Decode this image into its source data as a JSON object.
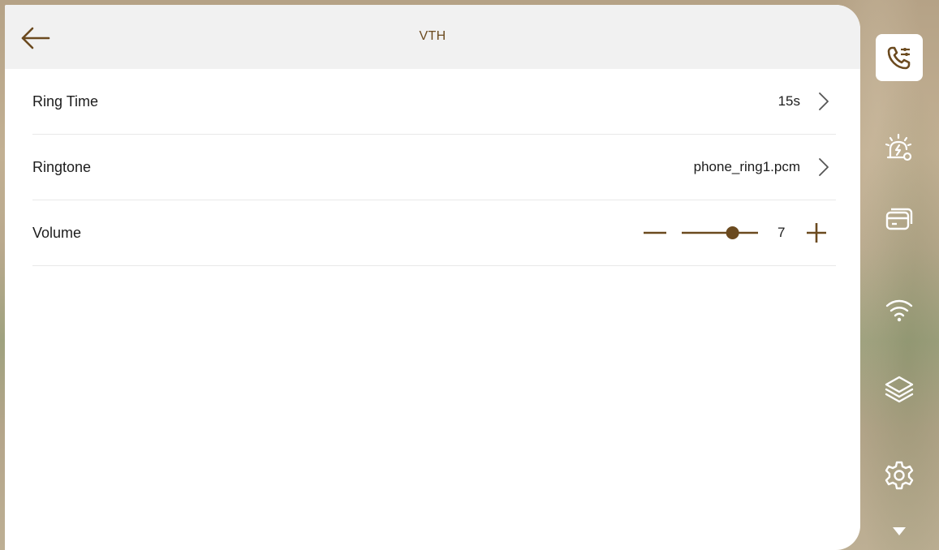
{
  "header": {
    "title": "VTH",
    "back_icon": "arrow-left-icon"
  },
  "settings": [
    {
      "label": "Ring Time",
      "value": "15s"
    },
    {
      "label": "Ringtone",
      "value": "phone_ring1.pcm"
    },
    {
      "label": "Volume",
      "value": "7",
      "level": 7
    }
  ],
  "sidebar": {
    "items": [
      {
        "icon": "call-settings-icon",
        "active": true
      },
      {
        "icon": "alarm-settings-icon",
        "active": false
      },
      {
        "icon": "card-icon",
        "active": false
      },
      {
        "icon": "wifi-icon",
        "active": false
      },
      {
        "icon": "layers-icon",
        "active": false
      },
      {
        "icon": "gear-icon",
        "active": false
      },
      {
        "icon": "triangle-down-icon",
        "active": false
      }
    ]
  },
  "colors": {
    "accent": "#6b4a1f",
    "header_bg": "#f1f1f1",
    "panel_bg": "#ffffff",
    "text": "#1c1c1c"
  }
}
